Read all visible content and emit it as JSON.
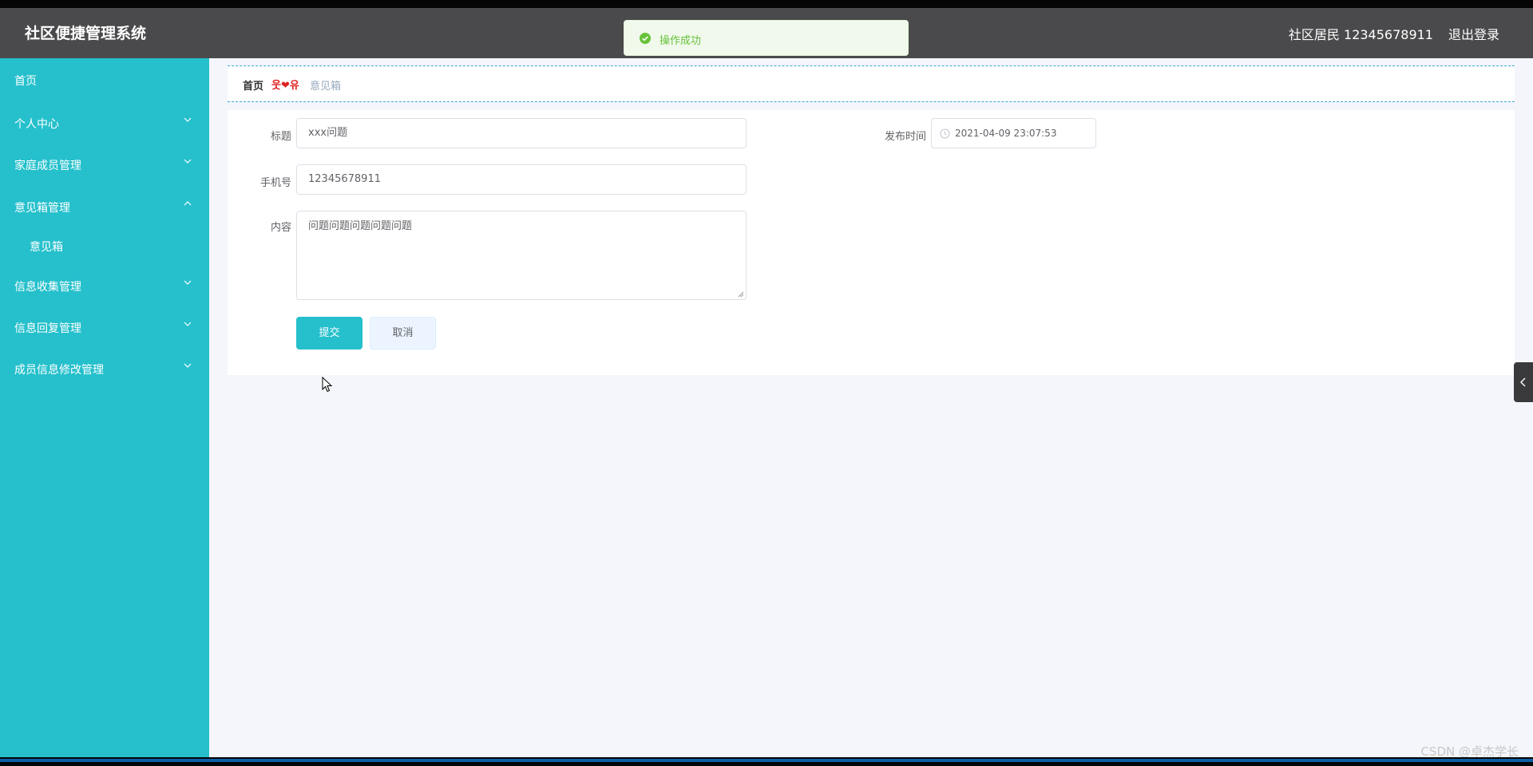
{
  "app": {
    "title": "社区便捷管理系统"
  },
  "header": {
    "user": "社区居民 12345678911",
    "logout": "退出登录"
  },
  "toast": {
    "message": "操作成功",
    "color": "#67c23a"
  },
  "sidebar": {
    "background": "#25c0cc",
    "items": [
      {
        "label": "首页"
      },
      {
        "label": "个人中心",
        "chevron": "chevron-down-icon"
      },
      {
        "label": "家庭成员管理",
        "chevron": "chevron-down-icon"
      },
      {
        "label": "意见箱管理",
        "chevron": "chevron-up-icon"
      },
      {
        "label": "意见箱"
      },
      {
        "label": "信息收集管理",
        "chevron": "chevron-down-icon"
      },
      {
        "label": "信息回复管理",
        "chevron": "chevron-down-icon"
      },
      {
        "label": "成员信息修改管理",
        "chevron": "chevron-down-icon"
      }
    ]
  },
  "breadcrumb": {
    "home": "首页",
    "separator": "웃❤유",
    "current": "意见箱"
  },
  "form": {
    "title_label": "标题",
    "title_value": "xxx问题",
    "time_label": "发布时间",
    "time_value": "2021-04-09 23:07:53",
    "phone_label": "手机号",
    "phone_value": "12345678911",
    "content_label": "内容",
    "content_value": "问题问题问题问题问题",
    "submit": "提交",
    "cancel": "取消"
  },
  "watermark": "CSDN @卓杰学长"
}
